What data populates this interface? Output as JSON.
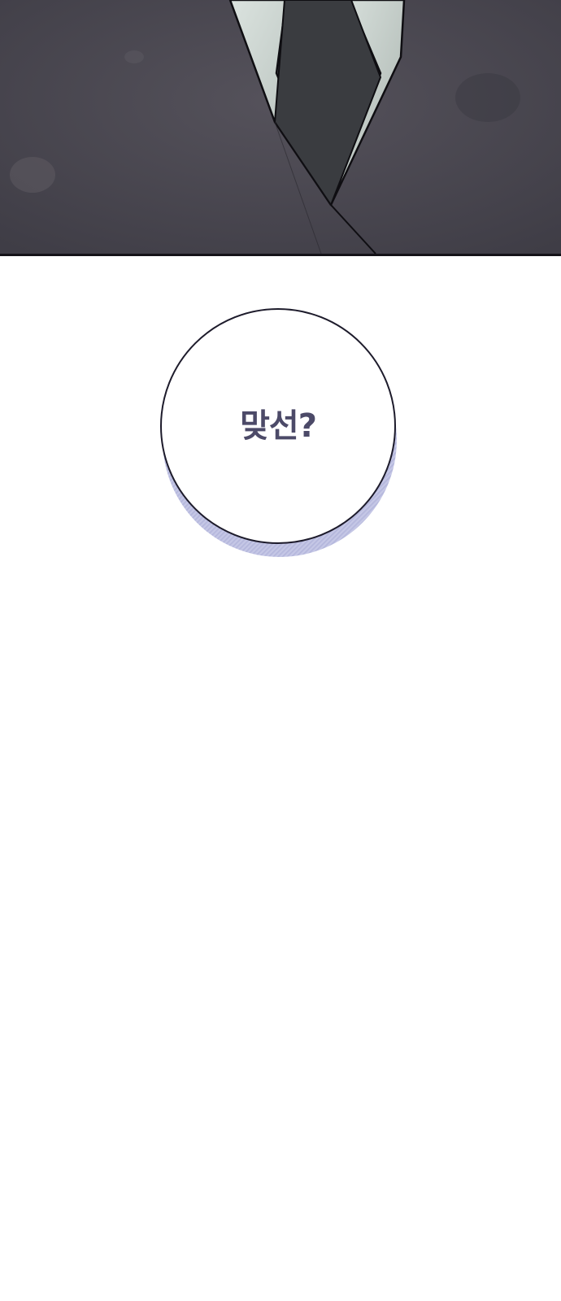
{
  "comic": {
    "top_panel": {
      "icon": "suit-collar-illustration"
    },
    "speech_bubble": {
      "text": "맞선?"
    }
  },
  "colors": {
    "panel_bg": "#4b4952",
    "shirt": "#c5cec9",
    "tie": "#3c3f42",
    "bubble_text": "#4c4a68",
    "bubble_shadow": "#b7b9de"
  }
}
